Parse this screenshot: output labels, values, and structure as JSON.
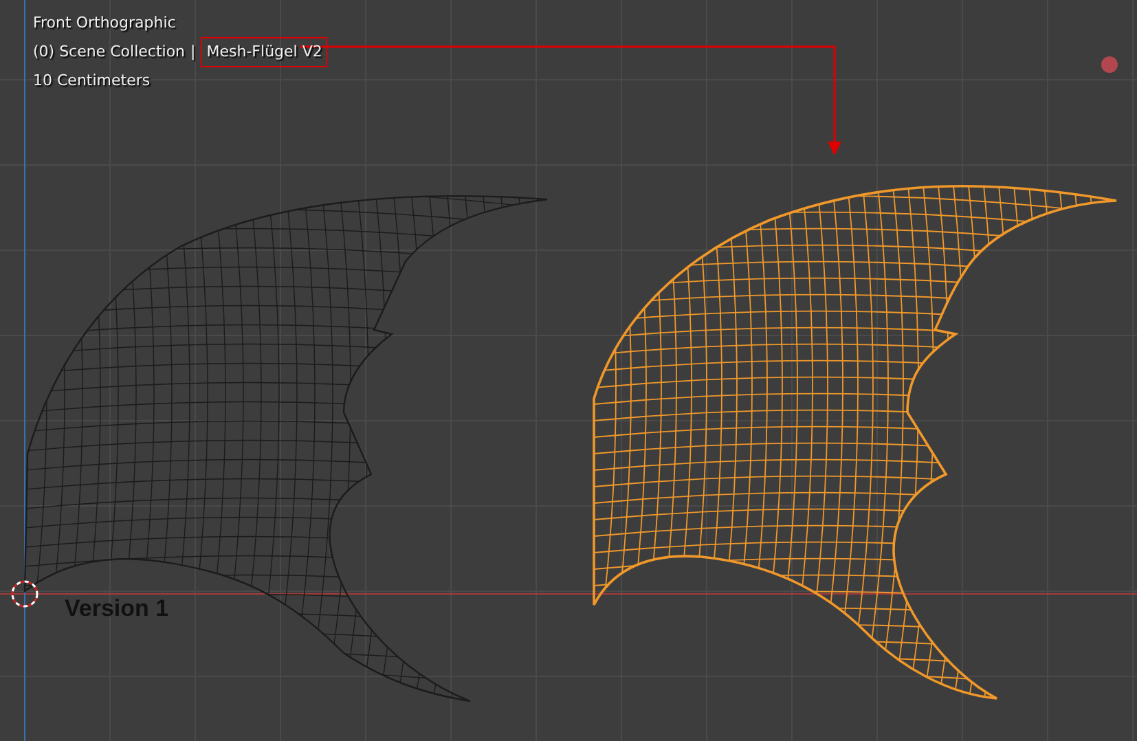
{
  "viewport": {
    "view_name": "Front Orthographic",
    "collection": "(0) Scene Collection",
    "separator": "|",
    "active_object": "Mesh-Flügel V2",
    "active_highlighted": true,
    "scale": "10 Centimeters"
  },
  "objects": [
    {
      "label": "Version 1",
      "selected": false
    },
    {
      "selected": true
    }
  ]
}
